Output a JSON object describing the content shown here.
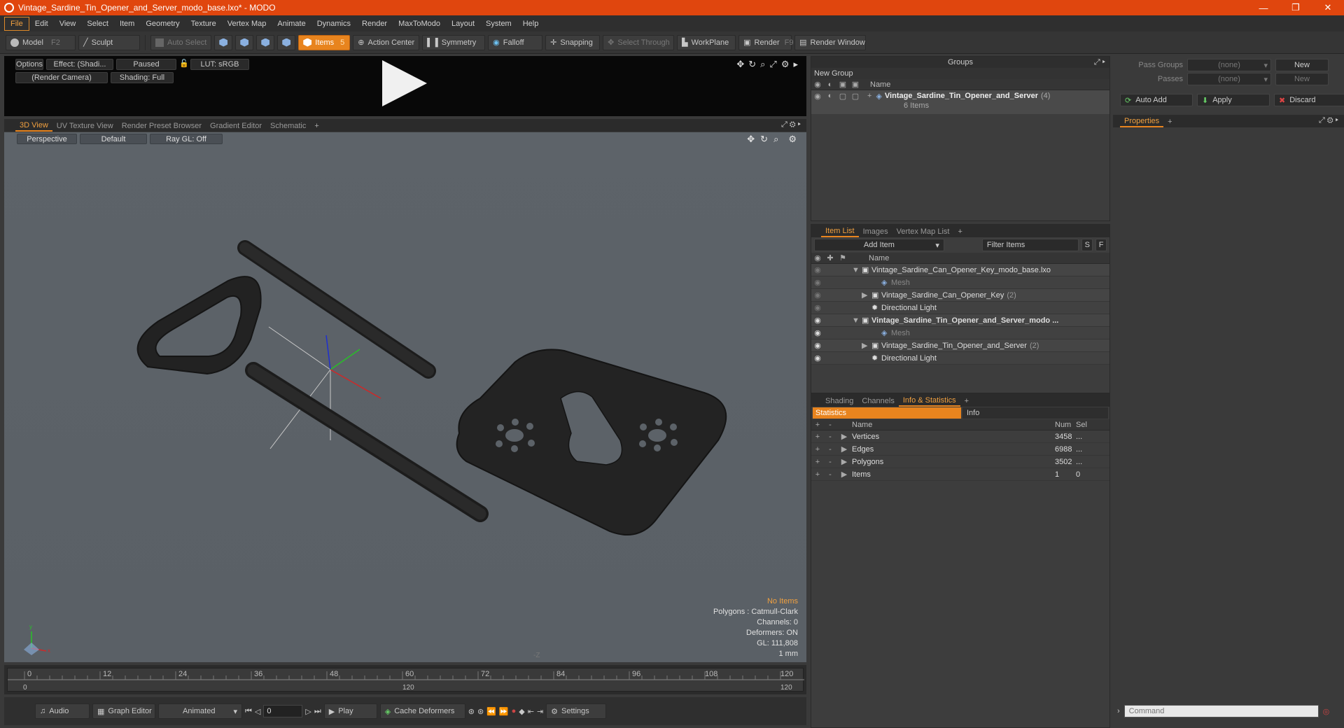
{
  "window": {
    "title": "Vintage_Sardine_Tin_Opener_and_Server_modo_base.lxo* - MODO",
    "minimize": "—",
    "restore": "❐",
    "close": "✕"
  },
  "menu": [
    "File",
    "Edit",
    "View",
    "Select",
    "Item",
    "Geometry",
    "Texture",
    "Vertex Map",
    "Animate",
    "Dynamics",
    "Render",
    "MaxToModo",
    "Layout",
    "System",
    "Help"
  ],
  "toolbar": {
    "model": "Model",
    "model_key": "F2",
    "sculpt": "Sculpt",
    "auto_select": "Auto Select",
    "items": "Items",
    "items_key": "5",
    "action_center": "Action Center",
    "symmetry": "Symmetry",
    "falloff": "Falloff",
    "snapping": "Snapping",
    "select_through": "Select Through",
    "workplane": "WorkPlane",
    "render": "Render",
    "render_key": "F9",
    "render_window": "Render Window"
  },
  "preview": {
    "options": "Options",
    "effect": "Effect: (Shadi...",
    "paused": "Paused",
    "lut": "LUT: sRGB",
    "camera": "(Render Camera)",
    "shading": "Shading: Full"
  },
  "viewport_tabs": [
    "3D View",
    "UV Texture View",
    "Render Preset Browser",
    "Gradient Editor",
    "Schematic",
    "+"
  ],
  "viewport": {
    "perspective": "Perspective",
    "default": "Default",
    "raygl": "Ray GL: Off",
    "no_items": "No Items",
    "polygons": "Polygons : Catmull-Clark",
    "channels": "Channels: 0",
    "deformers": "Deformers: ON",
    "gl": "GL: 111,808",
    "unit": "1 mm",
    "axis_z": "-Z"
  },
  "timeline": {
    "ticks": [
      "0",
      "12",
      "24",
      "36",
      "48",
      "60",
      "72",
      "84",
      "96",
      "108",
      "120"
    ],
    "sub_start": "0",
    "sub_mid": "120",
    "sub_end": "120"
  },
  "bottombar": {
    "audio": "Audio",
    "graph_editor": "Graph Editor",
    "animated": "Animated",
    "frame": "0",
    "play": "Play",
    "cache_deformers": "Cache Deformers",
    "settings": "Settings"
  },
  "groups": {
    "title": "Groups",
    "new_group": "New Group",
    "name_col": "Name",
    "item_name": "Vintage_Sardine_Tin_Opener_and_Server",
    "item_count": "(4)",
    "item_sub": "6 Items"
  },
  "pass": {
    "pass_groups_label": "Pass Groups",
    "pass_groups_value": "(none)",
    "new": "New",
    "passes_label": "Passes",
    "passes_value": "(none)",
    "new2": "New"
  },
  "actions": {
    "auto_add": "Auto Add",
    "apply": "Apply",
    "discard": "Discard"
  },
  "properties": {
    "tab": "Properties",
    "plus": "+"
  },
  "itemlist": {
    "tabs": [
      "Item List",
      "Images",
      "Vertex Map List",
      "+"
    ],
    "add_item": "Add Item",
    "filter": "Filter Items",
    "s": "S",
    "f": "F",
    "name_col": "Name",
    "rows": [
      {
        "label": "Vintage_Sardine_Can_Opener_Key_modo_base.lxo",
        "indent": 0,
        "bold": false,
        "eye": false,
        "arrow": "▼",
        "count": ""
      },
      {
        "label": "Mesh",
        "indent": 2,
        "bold": false,
        "eye": false,
        "arrow": "",
        "count": "",
        "dim": true
      },
      {
        "label": "Vintage_Sardine_Can_Opener_Key",
        "indent": 1,
        "bold": false,
        "eye": false,
        "arrow": "▶",
        "count": "(2)"
      },
      {
        "label": "Directional Light",
        "indent": 1,
        "bold": false,
        "eye": false,
        "arrow": "",
        "count": ""
      },
      {
        "label": "Vintage_Sardine_Tin_Opener_and_Server_modo ...",
        "indent": 0,
        "bold": true,
        "eye": true,
        "arrow": "▼",
        "count": ""
      },
      {
        "label": "Mesh",
        "indent": 2,
        "bold": false,
        "eye": true,
        "arrow": "",
        "count": "",
        "dim": true
      },
      {
        "label": "Vintage_Sardine_Tin_Opener_and_Server",
        "indent": 1,
        "bold": false,
        "eye": true,
        "arrow": "▶",
        "count": "(2)"
      },
      {
        "label": "Directional Light",
        "indent": 1,
        "bold": false,
        "eye": true,
        "arrow": "",
        "count": ""
      }
    ]
  },
  "stats": {
    "tabs": [
      "Shading",
      "Channels",
      "Info & Statistics",
      "+"
    ],
    "statistics": "Statistics",
    "info": "Info",
    "cols": {
      "name": "Name",
      "num": "Num",
      "sel": "Sel"
    },
    "rows": [
      {
        "name": "Vertices",
        "num": "3458",
        "sel": "..."
      },
      {
        "name": "Edges",
        "num": "6988",
        "sel": "..."
      },
      {
        "name": "Polygons",
        "num": "3502",
        "sel": "..."
      },
      {
        "name": "Items",
        "num": "1",
        "sel": "0"
      }
    ]
  },
  "command": {
    "placeholder": "Command"
  }
}
